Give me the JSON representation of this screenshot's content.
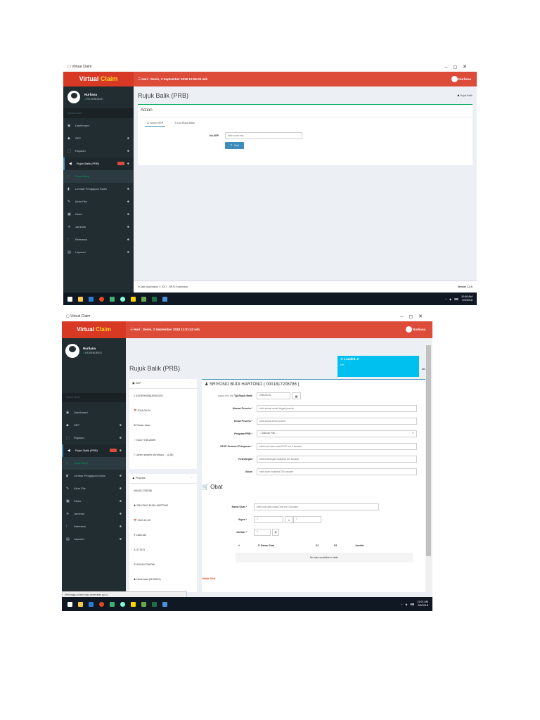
{
  "window": {
    "title": "Virtual Claim"
  },
  "app": {
    "logo_main": "Virtual ",
    "logo_accent": "Claim",
    "user_name": "Nurliana",
    "user_status": "RS.HENDRATI",
    "menu_header": "Virtual Claim",
    "menu": [
      {
        "icon": "◉",
        "label": "Dashboard",
        "chev": ""
      },
      {
        "icon": "◆",
        "label": "SEP",
        "chev": "✱"
      },
      {
        "icon": "⬚",
        "label": "Rujukan",
        "chev": "✱"
      },
      {
        "icon": "◀",
        "label": "Rujuk Balik (PRB)",
        "chev": "✱"
      },
      {
        "icon": "○",
        "label": "Form Entry",
        "chev": ""
      },
      {
        "icon": "▮",
        "label": "Lembar Pengajuan Klaim",
        "chev": "✱"
      },
      {
        "icon": "✎",
        "label": "Kirim File",
        "chev": "✱"
      },
      {
        "icon": "▣",
        "label": "Klaim",
        "chev": "✱"
      },
      {
        "icon": "✛",
        "label": "Jaminan",
        "chev": "✱"
      },
      {
        "icon": "⁝",
        "label": "Referensi",
        "chev": "✱"
      },
      {
        "icon": "▤",
        "label": "Laporan",
        "chev": "✱"
      }
    ],
    "footer_left": "VClaim Application © 2017 - BPJS Kesehatan",
    "footer_version": "Version 1.3.0"
  },
  "shot1": {
    "header_date": "☰ Hari : Senin, 3 September 2018 10:56:03 wib",
    "page_title": "Rujuk Balik (PRB)",
    "breadcrumb": "☗ Rujuk Balik",
    "box_title": "Action",
    "tab1": "☑ Nomor SEP",
    "tab2": "↻ List Rujuk Balik",
    "label_nosep": "No.SEP",
    "placeholder_nosep": "ketik nomor sep",
    "btn_cari": "🔍 Cari",
    "clock_time": "10:56 AM",
    "clock_date": "9/3/2018"
  },
  "shot2": {
    "header_date": "☰ Hari : Senin, 3 September 2018 11:01:42 wib",
    "page_title": "Rujuk Balik (PRB)",
    "crumb_tail": "alik",
    "toast_title": "⚙ Loaded..!!",
    "toast_body": "OK",
    "sep_panel_title": "▣ SEP",
    "sep_items": [
      "1 0151R0040818V001102",
      "📅 2018-08-04",
      "⚙ Rawat Jalan",
      "♡ KULIT KELAMIN",
      "⚕ Lichen simplex chronicus ... (L28)"
    ],
    "peserta_panel_title": "♟ Peserta",
    "peserta_items": [
      "0001817208786",
      "♟ SRIYONO BUDI HARTONO",
      "📅 1949-10-25",
      "⚲ Laki-Laki",
      "♙ 017431",
      "✆ 0001817208786",
      "♟ Klinik Asia (0151R10)"
    ],
    "patient_title": "♟ SRIYONO BUDI HARTONO ( 0001817208786 )",
    "lbl_tgl_prefix": "(yyyy-mm-dd)",
    "lbl_tgl": "Tgl.Rujuk Balik",
    "val_tgl": "2018-09-04",
    "lbl_alamat": "Alamat Peserta *",
    "ph_alamat": "ketik alamat rumah tinggal peserta",
    "lbl_email": "Email Peserta *",
    "ph_email": "ketik alamat email peserta",
    "lbl_program": "Program PRB *",
    "val_program": "-- Silahkan Pilih --",
    "lbl_dpjp": "DPJP Pemberi Pelayanan *",
    "ph_dpjp": "ketik kode atau nama DPJP min 3 karakter",
    "lbl_ket": "Keterangan",
    "ph_ket": "ketik keterangan maksimal 100 karakter",
    "lbl_saran": "Saran",
    "ph_saran": "ketik saran maksimal 200 karakter",
    "obat_title": "🛒 Obat",
    "lbl_nama_obat": "Nama Obat *",
    "ph_nama_obat": "ketik kode atau nama Obat min 3 karakter",
    "lbl_signa": "Signa *",
    "val_signa1": "0",
    "val_x": "x",
    "val_signa2": "0",
    "lbl_jumlah": "Jumlah *",
    "val_jumlah": "0",
    "th_no": "#",
    "th_nama": "Nama Obat",
    "th_s1": "S1",
    "th_s2": "S2",
    "th_jumlah": "Jumlah",
    "no_data": "No data available in table",
    "wajib": "*Wajib Diisi",
    "statusbar": "Menunggu vclaim.bpjs-kesehatan.go.id...",
    "clock_time": "11:01 AM",
    "clock_date": "9/3/2018"
  }
}
